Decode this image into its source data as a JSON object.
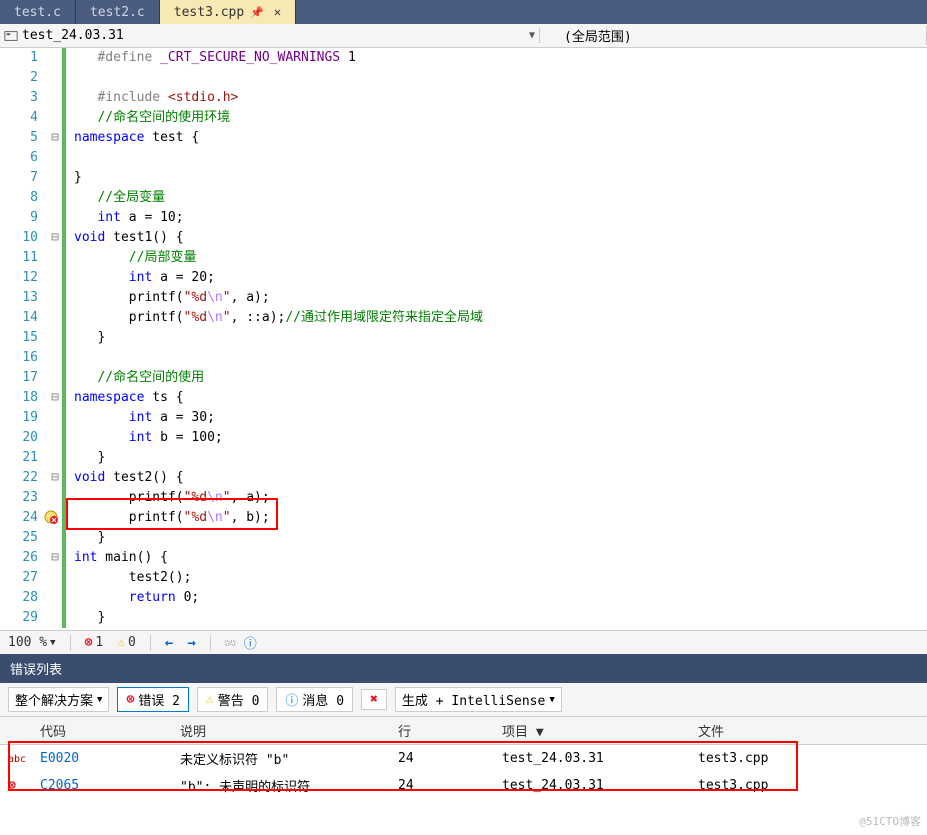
{
  "tabs": [
    {
      "label": "test.c",
      "active": false
    },
    {
      "label": "test2.c",
      "active": false
    },
    {
      "label": "test3.cpp",
      "active": true
    }
  ],
  "crumbs": {
    "left": "test_24.03.31",
    "right": "(全局范围)"
  },
  "code": {
    "l1_define": "#define",
    "l1_macro": "_CRT_SECURE_NO_WARNINGS",
    "l1_val": " 1",
    "l3_include": "#include",
    "l3_hdr": "<stdio.h>",
    "l4_cm": "//命名空间的使用环境",
    "l5_a": "namespace",
    "l5_b": " test {",
    "l7_close": "}",
    "l8_cm": "//全局变量",
    "l9_a": "int",
    "l9_b": " a = 10;",
    "l10_a": "void",
    "l10_b": " test1() {",
    "l11_cm": "//局部变量",
    "l12_a": "int",
    "l12_b": " a = 20;",
    "l13_a": "printf(",
    "l13_s": "\"%d",
    "l13_e": "\\n",
    "l13_s2": "\"",
    "l13_b": ", a);",
    "l14_a": "printf(",
    "l14_s": "\"%d",
    "l14_e": "\\n",
    "l14_s2": "\"",
    "l14_b": ", ::a);",
    "l14_cm": "//通过作用域限定符来指定全局域",
    "l15_close": "}",
    "l17_cm": "//命名空间的使用",
    "l18_a": "namespace",
    "l18_b": " ts {",
    "l19_a": "int",
    "l19_b": " a = 30;",
    "l20_a": "int",
    "l20_b": " b = 100;",
    "l21_close": "}",
    "l22_a": "void",
    "l22_b": " test2() {",
    "l23_a": "printf(",
    "l23_s": "\"%d",
    "l23_e": "\\n",
    "l23_s2": "\"",
    "l23_b": ", a);",
    "l24_a": "printf(",
    "l24_s": "\"%d",
    "l24_e": "\\n",
    "l24_s2": "\"",
    "l24_b": ", b);",
    "l25_close": "}",
    "l26_a": "int",
    "l26_b": " main() {",
    "l27": "test2();",
    "l28_a": "return",
    "l28_b": " 0;",
    "l29_close": "}"
  },
  "status": {
    "zoom": "100 %",
    "err_count": "1",
    "warn_count": "0"
  },
  "errlist": {
    "title": "错误列表",
    "scope": "整个解决方案",
    "btn_err": "错误 2",
    "btn_warn": "警告 0",
    "btn_msg": "消息 0",
    "source": "生成 + IntelliSense",
    "cols": {
      "code": "代码",
      "desc": "说明",
      "line": "行",
      "proj": "项目",
      "file": "文件"
    },
    "rows": [
      {
        "icon": "abc",
        "code": "E0020",
        "desc": "未定义标识符 \"b\"",
        "line": "24",
        "proj": "test_24.03.31",
        "file": "test3.cpp"
      },
      {
        "icon": "x",
        "code": "C2065",
        "desc": "\"b\": 未声明的标识符",
        "line": "24",
        "proj": "test_24.03.31",
        "file": "test3.cpp"
      }
    ]
  },
  "watermark": "@51CTO博客"
}
